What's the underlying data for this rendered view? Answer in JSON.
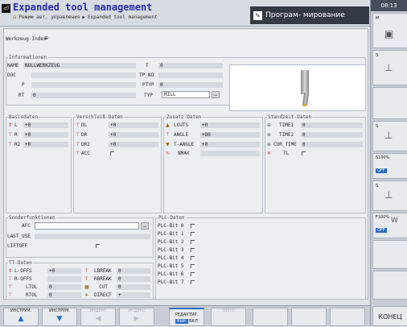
{
  "header": {
    "title": "Expanded tool management",
    "mode": "Режим авт. управления",
    "crumb_sep": "▶",
    "crumb_page": "Expanded tool management",
    "program_mode": "Програм- мирование"
  },
  "clock": "08:13",
  "right_panel": {
    "m": "M",
    "s1": "S",
    "s2": "S",
    "s3": "S",
    "s100": "S100%",
    "off1": "OFF",
    "s4": "S",
    "f100": "F100%",
    "off2": "OFF",
    "end": "КОНЕЦ"
  },
  "main": {
    "index_label": "Werkzeug-Index",
    "index_icon": "⊕",
    "info": {
      "title": "Informationen",
      "name_label": "NAME",
      "name_value": "NULLWERKZEUG",
      "doc_label": "DOC",
      "p_label": "P",
      "rt_label": "RT",
      "rt_value": "0",
      "t_label": "T",
      "t_value": "0",
      "tpno_label": "TP_NO",
      "ptyp_label": "PTYP",
      "ptyp_value": "0",
      "typ_label": "TYP",
      "typ_value": "MILL"
    },
    "basis": {
      "title": "Basisdaten",
      "rows": [
        {
          "label": "L",
          "value": "+0"
        },
        {
          "label": "R",
          "value": "+0"
        },
        {
          "label": "R2",
          "value": "+0"
        }
      ]
    },
    "wear": {
      "title": "Verschleiß-Daten",
      "rows": [
        {
          "label": "DL",
          "value": "+0"
        },
        {
          "label": "DR",
          "value": "+0"
        },
        {
          "label": "DR2",
          "value": "+0"
        },
        {
          "label": "ACC",
          "value": ""
        }
      ]
    },
    "extra": {
      "title": "Zusatz-Daten",
      "rows": [
        {
          "label": "LCUTS",
          "value": "+0"
        },
        {
          "label": "ANGLE",
          "value": "+80"
        },
        {
          "label": "T-ANGLE",
          "value": "+0"
        },
        {
          "label": "NMAX",
          "value": ""
        }
      ]
    },
    "life": {
      "title": "Standzeit-Daten",
      "rows": [
        {
          "label": "TIME1",
          "value": "0"
        },
        {
          "label": "TIME2",
          "value": "0"
        },
        {
          "label": "CUR_TIME",
          "value": "0"
        },
        {
          "label": "TL",
          "value": ""
        }
      ]
    },
    "special": {
      "title": "Sonderfunktionen",
      "afc_label": "AFC",
      "lastuse_label": "LAST_USE",
      "liftoff_label": "LIFTOFF"
    },
    "plc": {
      "title": "PLC-Daten",
      "bits": [
        "PLC-Bit 0",
        "PLC-Bit 1",
        "PLC-Bit 2",
        "PLC-Bit 3",
        "PLC-Bit 4",
        "PLC-Bit 5",
        "PLC-Bit 6",
        "PLC-Bit 7"
      ]
    },
    "tt": {
      "title": "TT-Daten",
      "left": [
        {
          "label": "L-OFFS",
          "value": "+0"
        },
        {
          "label": "R-OFFS",
          "value": ""
        },
        {
          "label": "LTOL",
          "value": "0"
        },
        {
          "label": "RTOL",
          "value": "0"
        }
      ],
      "right": [
        {
          "label": "LBREAK",
          "value": "0"
        },
        {
          "label": "RBREAK",
          "value": "0"
        },
        {
          "label": "CUT",
          "value": "0"
        },
        {
          "label": "DIRECT",
          "value": "+"
        }
      ]
    }
  },
  "softkeys": {
    "k1": "ИНСТРУМ.",
    "k2": "ИНСТРУМ.",
    "k3": "ИНДЕКС",
    "k4": "ИНДЕКС",
    "k5": "РЕДАКТИР.",
    "k5_off": "ВЫК",
    "k5_on": "ВКЛ",
    "k6": "ОКНО"
  }
}
